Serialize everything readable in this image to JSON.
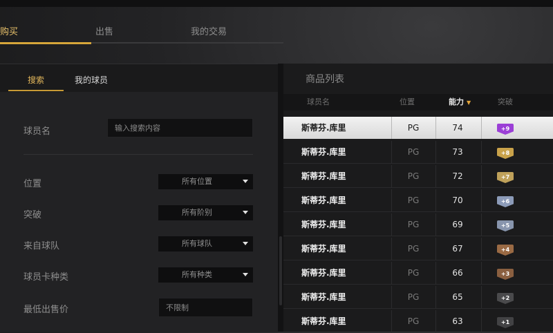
{
  "main_tabs": [
    {
      "label": "购买",
      "active": true
    },
    {
      "label": "出售",
      "active": false
    },
    {
      "label": "我的交易",
      "active": false
    }
  ],
  "left": {
    "sub_tabs": [
      {
        "label": "搜索",
        "active": true
      },
      {
        "label": "我的球员",
        "active": false
      }
    ],
    "name_label": "球员名",
    "name_placeholder": "输入搜索内容",
    "filters": [
      {
        "label": "位置",
        "value": "所有位置"
      },
      {
        "label": "突破",
        "value": "所有阶别"
      },
      {
        "label": "来自球队",
        "value": "所有球队"
      },
      {
        "label": "球员卡种类",
        "value": "所有种类"
      }
    ],
    "min_price_label": "最低出售价",
    "min_price_value": "不限制"
  },
  "right": {
    "title": "商品列表",
    "headers": {
      "name": "球员名",
      "position": "位置",
      "rating": "能力",
      "breakthrough": "突破"
    },
    "rows": [
      {
        "name": "斯蒂芬.库里",
        "position": "PG",
        "rating": "74",
        "badge": "+9",
        "badge_color": "#9b3fd6",
        "selected": true
      },
      {
        "name": "斯蒂芬.库里",
        "position": "PG",
        "rating": "73",
        "badge": "+8",
        "badge_color": "#c9a24a"
      },
      {
        "name": "斯蒂芬.库里",
        "position": "PG",
        "rating": "72",
        "badge": "+7",
        "badge_color": "#bfa15a"
      },
      {
        "name": "斯蒂芬.库里",
        "position": "PG",
        "rating": "70",
        "badge": "+6",
        "badge_color": "#8c9bb8"
      },
      {
        "name": "斯蒂芬.库里",
        "position": "PG",
        "rating": "69",
        "badge": "+5",
        "badge_color": "#8895ad"
      },
      {
        "name": "斯蒂芬.库里",
        "position": "PG",
        "rating": "67",
        "badge": "+4",
        "badge_color": "#9a6a44"
      },
      {
        "name": "斯蒂芬.库里",
        "position": "PG",
        "rating": "66",
        "badge": "+3",
        "badge_color": "#8a5f40"
      },
      {
        "name": "斯蒂芬.库里",
        "position": "PG",
        "rating": "65",
        "badge": "+2",
        "badge_color": "#4a4a4c"
      },
      {
        "name": "斯蒂芬.库里",
        "position": "PG",
        "rating": "63",
        "badge": "+1",
        "badge_color": "#424244"
      }
    ]
  },
  "colors": {
    "accent": "#d7a63a",
    "sort_arrow": "#e2a43a"
  }
}
